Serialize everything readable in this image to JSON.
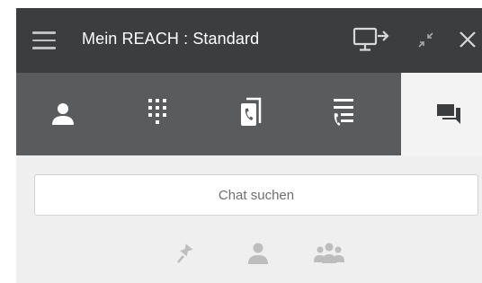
{
  "window": {
    "title": "Mein REACH : Standard"
  },
  "icons": {
    "menu": "hamburger-icon",
    "window_buttons": [
      "screen-share-icon",
      "minimize-icon",
      "close-icon"
    ],
    "tabs": [
      "contacts-icon",
      "dialpad-icon",
      "call-transfer-icon",
      "call-history-icon",
      "chat-icon"
    ],
    "filters": [
      "pin-icon",
      "single-contact-icon",
      "group-icon"
    ]
  },
  "tabs": {
    "active_index": 4
  },
  "chat": {
    "search_placeholder": "Chat suchen",
    "search_value": ""
  },
  "colors": {
    "titlebar": "#3b3d3f",
    "toolbar": "#595b5d",
    "active_tab": "#f3f3f3",
    "content_bg": "#efefef",
    "filter_icon": "#bdbdbd"
  }
}
